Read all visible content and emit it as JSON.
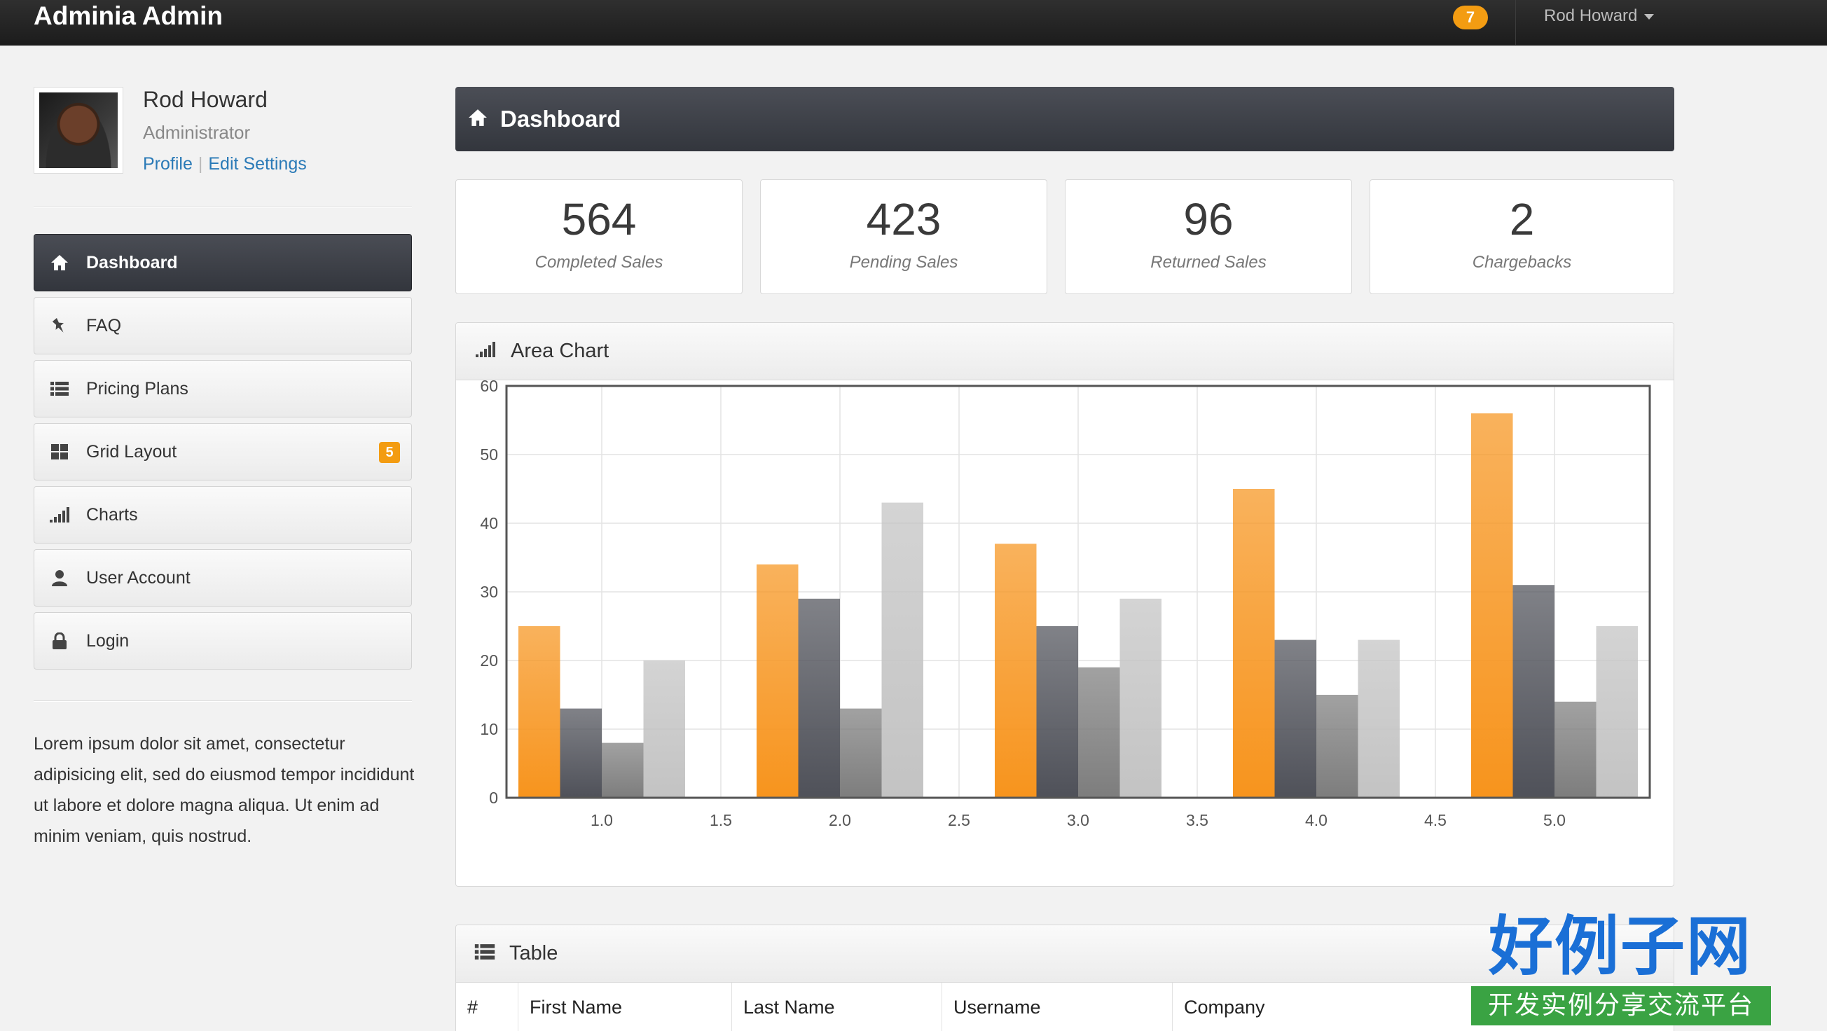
{
  "topbar": {
    "brand": "Adminia Admin",
    "notification_count": "7",
    "user_name": "Rod Howard"
  },
  "profile": {
    "name": "Rod Howard",
    "role": "Administrator",
    "profile_link": "Profile",
    "settings_link": "Edit Settings"
  },
  "sidebar": {
    "items": [
      {
        "label": "Dashboard",
        "icon": "home-icon",
        "active": true
      },
      {
        "label": "FAQ",
        "icon": "pushpin-icon"
      },
      {
        "label": "Pricing Plans",
        "icon": "list-icon"
      },
      {
        "label": "Grid Layout",
        "icon": "grid-icon",
        "badge": "5"
      },
      {
        "label": "Charts",
        "icon": "signal-bars-icon"
      },
      {
        "label": "User Account",
        "icon": "user-icon"
      },
      {
        "label": "Login",
        "icon": "lock-icon"
      }
    ],
    "description": "Lorem ipsum dolor sit amet, consectetur adipisicing elit, sed do eiusmod tempor incididunt ut labore et dolore magna aliqua. Ut enim ad minim veniam, quis nostrud."
  },
  "header": {
    "title": "Dashboard",
    "icon": "home-icon"
  },
  "stats": [
    {
      "value": "564",
      "label": "Completed Sales"
    },
    {
      "value": "423",
      "label": "Pending Sales"
    },
    {
      "value": "96",
      "label": "Returned Sales"
    },
    {
      "value": "2",
      "label": "Chargebacks"
    }
  ],
  "chart_panel": {
    "title": "Area Chart",
    "icon": "signal-bars-icon"
  },
  "chart_data": {
    "type": "bar",
    "title": "",
    "xlabel": "",
    "ylabel": "",
    "xlim": [
      0.6,
      5.4
    ],
    "ylim": [
      0,
      60
    ],
    "xticks": [
      "1.0",
      "1.5",
      "2.0",
      "2.5",
      "3.0",
      "3.5",
      "4.0",
      "4.5",
      "5.0"
    ],
    "yticks": [
      "0",
      "10",
      "20",
      "30",
      "40",
      "50",
      "60"
    ],
    "grid": true,
    "legend": "none",
    "x": [
      1,
      2,
      3,
      4,
      5
    ],
    "series": [
      {
        "color": "#f7941d",
        "values": [
          25,
          34,
          37,
          45,
          56
        ]
      },
      {
        "color": "#4f5159",
        "values": [
          13,
          29,
          25,
          23,
          31
        ]
      },
      {
        "color": "#7d7d7d",
        "values": [
          8,
          13,
          19,
          15,
          14
        ]
      },
      {
        "color": "#c3c3c3",
        "values": [
          20,
          43,
          29,
          23,
          25
        ]
      }
    ]
  },
  "table_panel": {
    "title": "Table",
    "icon": "table-icon",
    "columns": [
      "#",
      "First Name",
      "Last Name",
      "Username",
      "Company"
    ]
  },
  "watermark": {
    "text": "好例子网",
    "subtext": "开发实例分享交流平台"
  },
  "colors": {
    "accent": "#f39c12",
    "link": "#2a7ab7",
    "dark_header": "#3d4047"
  }
}
